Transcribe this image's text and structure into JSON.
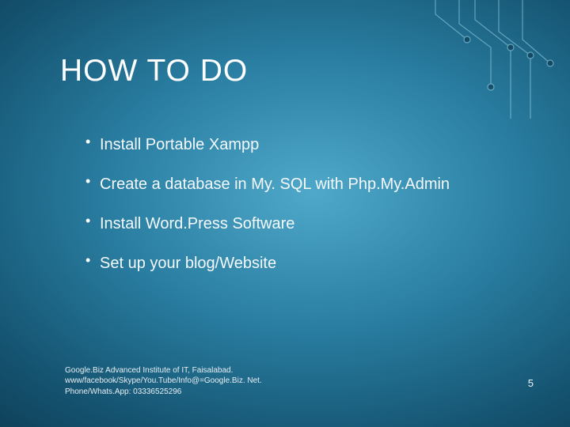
{
  "title": "HOW TO DO",
  "bullets": [
    "Install Portable Xampp",
    "Create a database in My. SQL with Php.My.Admin",
    "Install Word.Press Software",
    "Set up your blog/Website"
  ],
  "footer": {
    "line1": "Google.Biz Advanced Institute of IT, Faisalabad.",
    "line2": "www/facebook/Skype/You.Tube/Info@=Google.Biz. Net.",
    "line3": "Phone/Whats.App: 03336525296"
  },
  "page_number": "5"
}
